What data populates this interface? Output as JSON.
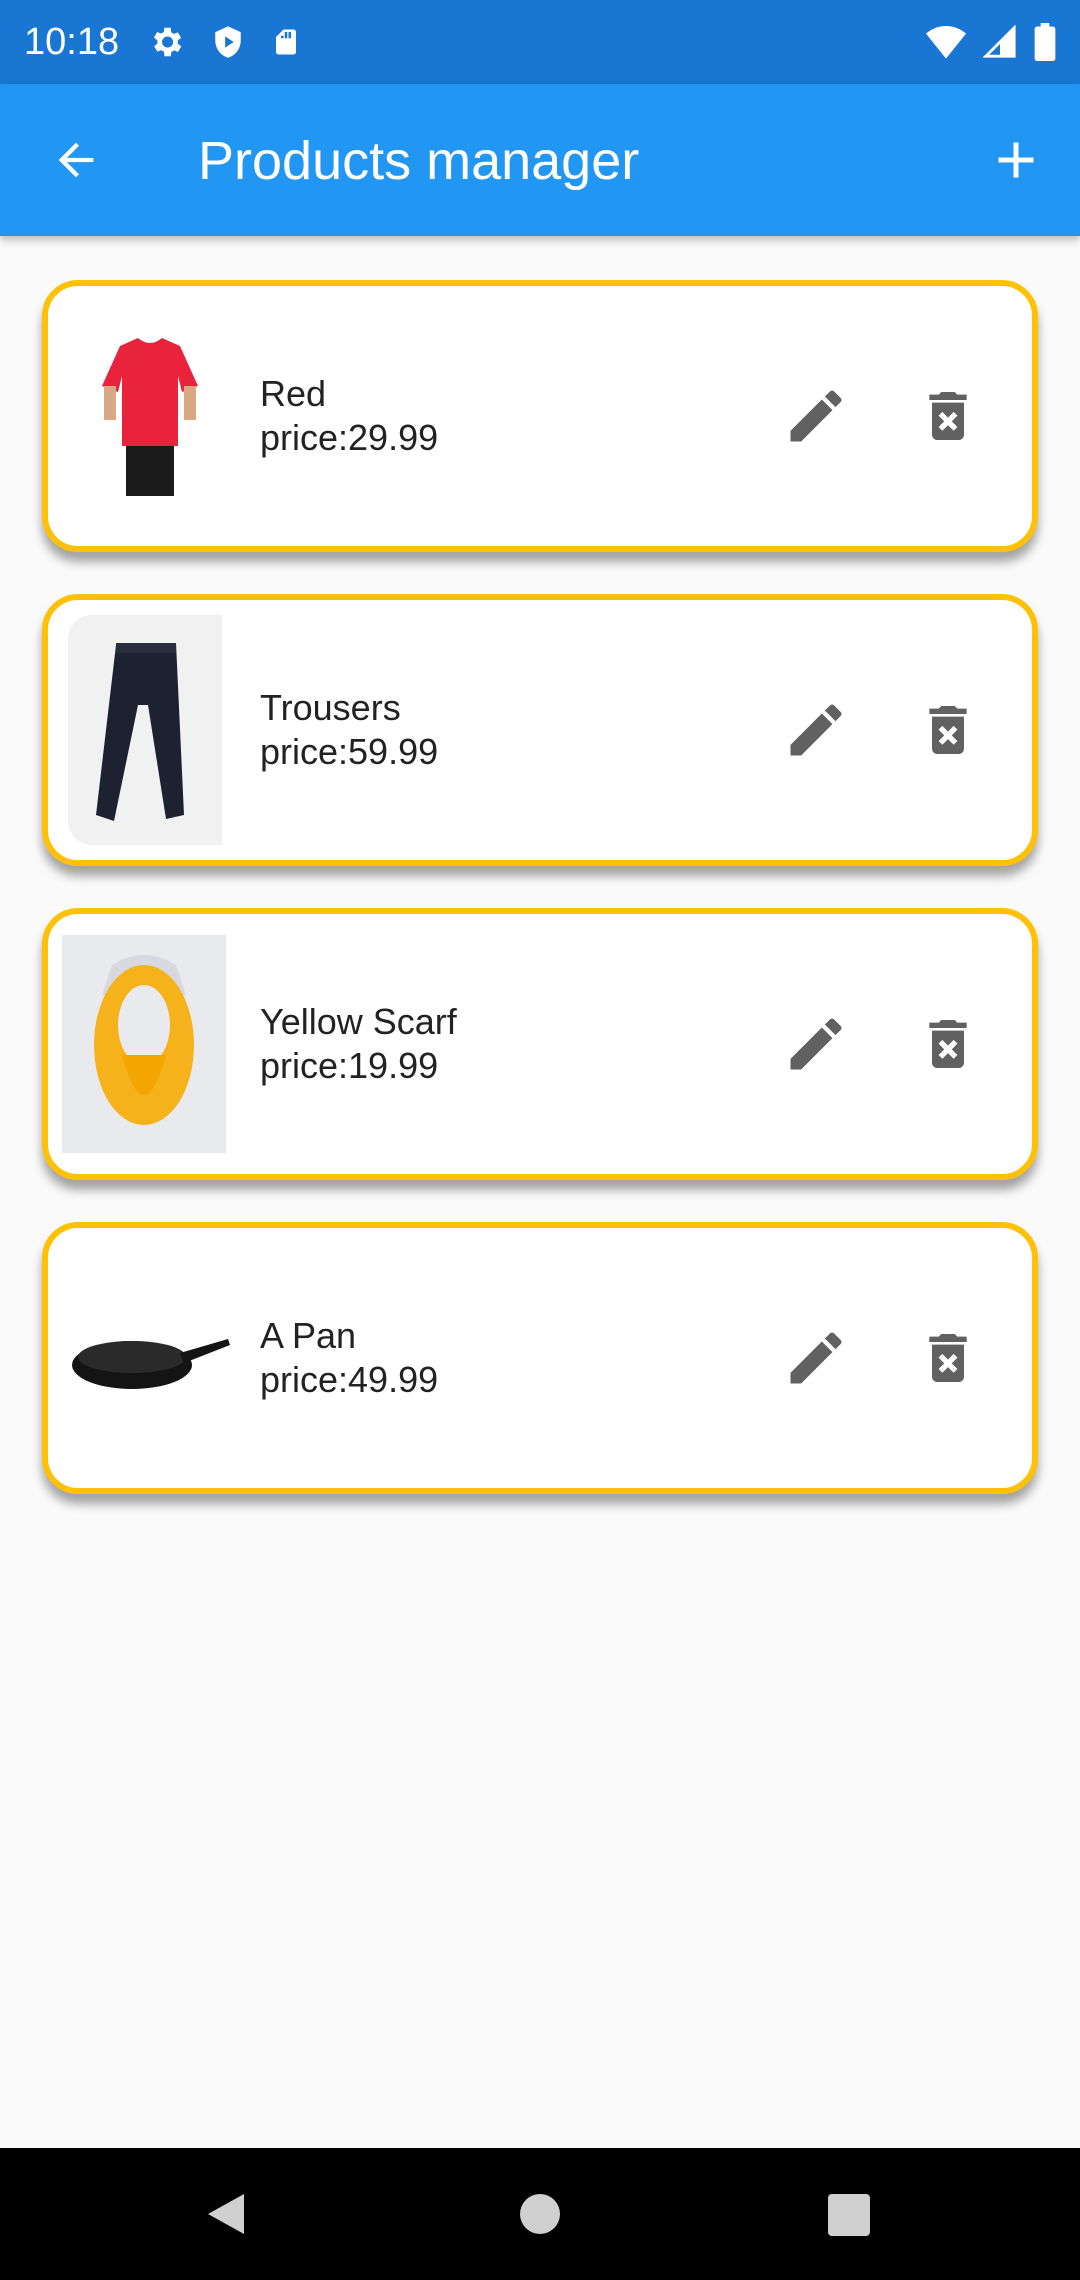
{
  "status_bar": {
    "time": "10:18",
    "left_icons": [
      "settings-icon",
      "shield-play-icon",
      "sd-card-icon"
    ],
    "right_icons": [
      "wifi-icon",
      "signal-icon",
      "battery-icon"
    ]
  },
  "app_bar": {
    "title": "Products manager",
    "back_icon": "arrow-back-icon",
    "add_icon": "add-icon",
    "color": "#2196f3"
  },
  "products": [
    {
      "name": "Red",
      "price_text": "price:29.99",
      "image": "red-tshirt"
    },
    {
      "name": "Trousers",
      "price_text": "price:59.99",
      "image": "black-trousers"
    },
    {
      "name": "Yellow Scarf",
      "price_text": "price:19.99",
      "image": "yellow-scarf"
    },
    {
      "name": "A Pan",
      "price_text": "price:49.99",
      "image": "cast-iron-pan"
    }
  ],
  "card_border_color": "#ffc107",
  "icon_color": "#616161",
  "nav_bar": {
    "buttons": [
      "back-triangle-icon",
      "home-circle-icon",
      "recents-square-icon"
    ]
  }
}
